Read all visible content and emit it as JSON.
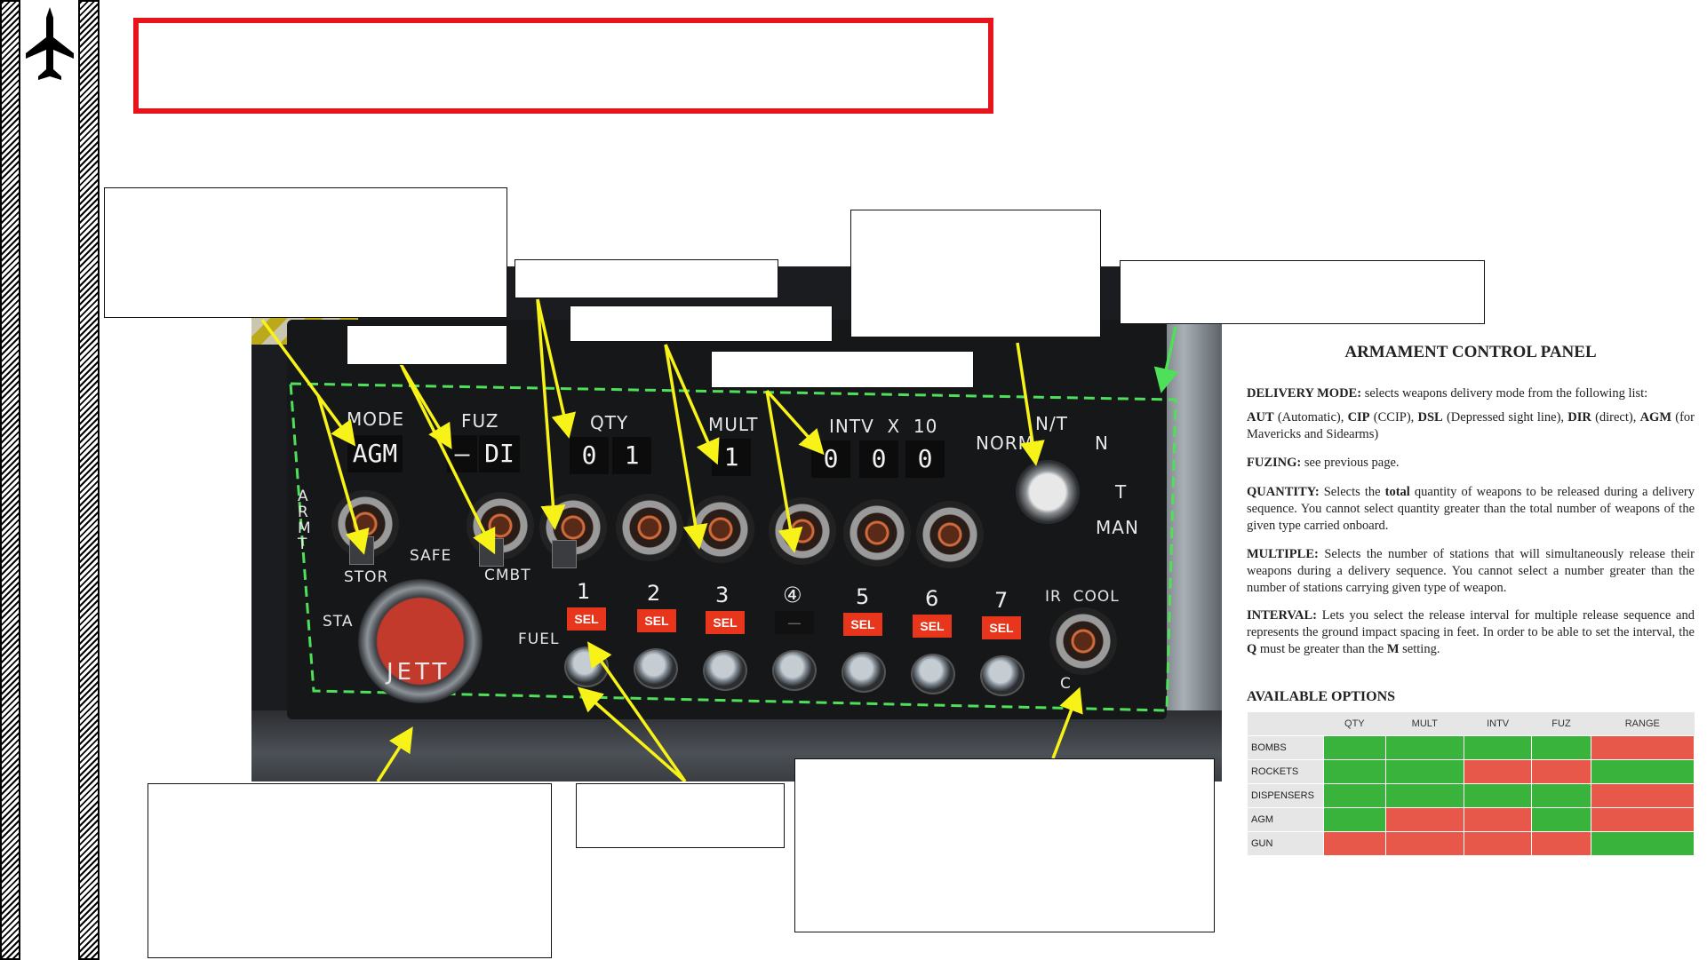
{
  "sidebar": {
    "icon": "aircraft-icon"
  },
  "panel": {
    "labels": {
      "mode": "MODE",
      "fuz": "FUZ",
      "qty": "QTY",
      "mult": "MULT",
      "intv": "INTV  X  10",
      "nt": "N/T",
      "norm": "NORM",
      "n": "N",
      "t": "T",
      "man": "MAN",
      "armt": "ARMT",
      "safe": "SAFE",
      "stor": "STOR",
      "cmbt": "CMBT",
      "sta": "STA",
      "fuel": "FUEL",
      "jett": "JETT",
      "ircool": "IR  COOL",
      "c": "C"
    },
    "displays": {
      "mode": "AGM",
      "fuz_dash": "—",
      "fuz": "DI",
      "qty_1": "0",
      "qty_2": "1",
      "mult": "1",
      "intv_1": "0",
      "intv_2": "0",
      "intv_3": "0"
    },
    "stations": [
      {
        "num": "1",
        "sel": "SEL"
      },
      {
        "num": "2",
        "sel": "SEL"
      },
      {
        "num": "3",
        "sel": "SEL"
      },
      {
        "num": "④",
        "sel": "—"
      },
      {
        "num": "5",
        "sel": "SEL"
      },
      {
        "num": "6",
        "sel": "SEL"
      },
      {
        "num": "7",
        "sel": "SEL"
      }
    ]
  },
  "reference": {
    "title": "ARMAMENT CONTROL PANEL",
    "delivery_term": "DELIVERY MODE:",
    "delivery_text": " selects weapons delivery mode from the following list:",
    "modes_line": [
      {
        "k": "AUT",
        "v": " (Automatic), "
      },
      {
        "k": "CIP",
        "v": " (CCIP), "
      },
      {
        "k": "DSL",
        "v": " (Depressed sight line), "
      },
      {
        "k": "DIR",
        "v": " (direct), "
      },
      {
        "k": "AGM",
        "v": " (for Mavericks and Sidearms)"
      }
    ],
    "fuzing_term": "FUZING:",
    "fuzing_text": " see previous page.",
    "quantity_term": "QUANTITY:",
    "quantity_text_a": " Selects the ",
    "quantity_bold": "total",
    "quantity_text_b": " quantity of weapons to be released during a delivery sequence. You cannot select quantity greater than the total number of weapons of the given type carried onboard.",
    "multiple_term": "MULTIPLE:",
    "multiple_text": " Selects the number of stations that will simultaneously release their weapons during a delivery sequence. You cannot select a number greater than the number of stations carrying given type of weapon.",
    "interval_term": "INTERVAL:",
    "interval_text_a": " Lets you select the release interval for multiple release sequence and represents the ground impact spacing in feet. In order to be able to set the interval, the ",
    "interval_q": "Q",
    "interval_text_b": " must be greater than the ",
    "interval_m": "M",
    "interval_text_c": " setting.",
    "options_title": "AVAILABLE OPTIONS",
    "options_headers": [
      "",
      "QTY",
      "MULT",
      "INTV",
      "FUZ",
      "RANGE"
    ],
    "options_rows": [
      {
        "name": "BOMBS",
        "cells": [
          "g",
          "g",
          "g",
          "g",
          "r"
        ]
      },
      {
        "name": "ROCKETS",
        "cells": [
          "g",
          "g",
          "r",
          "r",
          "g"
        ]
      },
      {
        "name": "DISPENSERS",
        "cells": [
          "g",
          "g",
          "g",
          "g",
          "r"
        ]
      },
      {
        "name": "AGM",
        "cells": [
          "g",
          "r",
          "r",
          "g",
          "r"
        ]
      },
      {
        "name": "GUN",
        "cells": [
          "r",
          "r",
          "r",
          "r",
          "g"
        ]
      }
    ],
    "colors": {
      "available": "#3ab33c",
      "unavailable": "#e8584a"
    }
  }
}
